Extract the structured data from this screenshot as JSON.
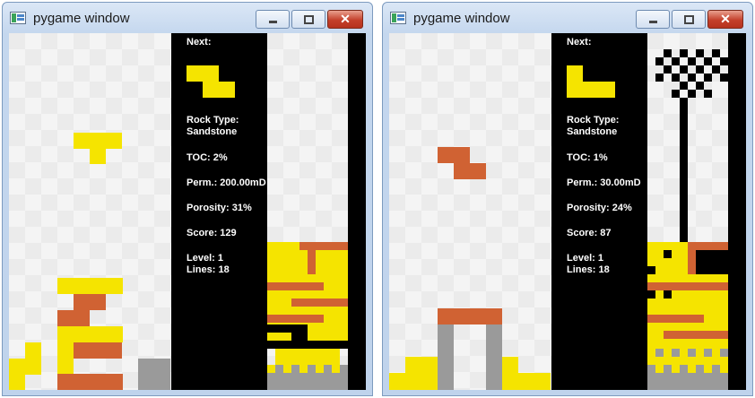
{
  "windows": [
    {
      "title": "pygame window",
      "controls": {
        "minimize": "",
        "maximize": "",
        "close": "✕"
      },
      "hud": {
        "next_label": "Next:",
        "rock_type_label": "Rock Type:",
        "rock_type": "Sandstone",
        "toc": "TOC: 2%",
        "perm": "Perm.: 200.00mD",
        "porosity": "Porosity: 31%",
        "score": "Score: 129",
        "level": "Level: 1",
        "lines": "Lines: 18"
      },
      "next_piece": "Z",
      "colors": {
        "yellow": "#f5e400",
        "orange": "#d06233",
        "gray": "#9a9a9a",
        "black": "#000000"
      }
    },
    {
      "title": "pygame window",
      "controls": {
        "minimize": "",
        "maximize": "",
        "close": "✕"
      },
      "hud": {
        "next_label": "Next:",
        "rock_type_label": "Rock Type:",
        "rock_type": "Sandstone",
        "toc": "TOC: 1%",
        "perm": "Perm.: 30.00mD",
        "porosity": "Porosity: 24%",
        "score": "Score: 87",
        "level": "Level: 1",
        "lines": "Lines: 18"
      },
      "next_piece": "L",
      "colors": {
        "yellow": "#f5e400",
        "orange": "#d06233",
        "gray": "#9a9a9a",
        "black": "#000000"
      }
    }
  ]
}
